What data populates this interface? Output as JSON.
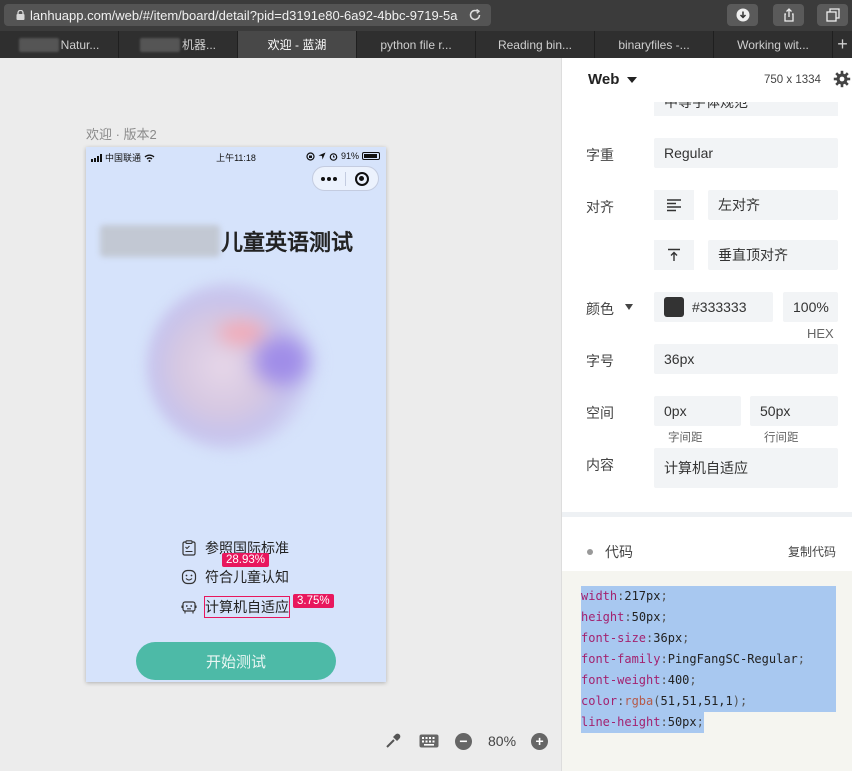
{
  "browser": {
    "url": "lanhuapp.com/web/#/item/board/detail?pid=d3191e80-6a92-4bbc-9719-5a",
    "tabs": [
      {
        "label": "Natur...",
        "active": false,
        "blurred": true
      },
      {
        "label": "机器...",
        "active": false,
        "blurred": true
      },
      {
        "label": "欢迎 - 蓝湖",
        "active": true,
        "blurred": false
      },
      {
        "label": "python file r...",
        "active": false,
        "blurred": false
      },
      {
        "label": "Reading bin...",
        "active": false,
        "blurred": false
      },
      {
        "label": "binaryfiles -...",
        "active": false,
        "blurred": false
      },
      {
        "label": "Working wit...",
        "active": false,
        "blurred": false
      }
    ],
    "new_tab": "+"
  },
  "canvas": {
    "artboard_title": "欢迎 · 版本2",
    "zoom": "80%",
    "zoom_minus": "−",
    "zoom_plus": "+"
  },
  "phone": {
    "status": {
      "carrier": "中国联通",
      "time": "上午11:18",
      "battery": "91%"
    },
    "title": "儿童英语测试",
    "features": [
      {
        "text": "参照国际标准",
        "icon": "clipboard-icon"
      },
      {
        "text": "符合儿童认知",
        "icon": "smile-icon"
      },
      {
        "text": "计算机自适应",
        "icon": "robot-icon",
        "selected": true
      }
    ],
    "overlay": {
      "spacing_top": "28.93%",
      "spacing_right": "3.75%"
    },
    "start_button": "开始测试"
  },
  "panel": {
    "platform": "Web",
    "size": "750 x 1334",
    "cut_field": "中等字体规范",
    "weight_label": "字重",
    "weight_value": "Regular",
    "align_label": "对齐",
    "align_h": "左对齐",
    "align_v": "垂直顶对齐",
    "color_label": "颜色",
    "color_hex": "#333333",
    "color_opacity": "100%",
    "color_mode": "HEX",
    "size_label": "字号",
    "font_size": "36px",
    "space_label": "空间",
    "letter_spacing": "0px",
    "line_height": "50px",
    "letter_spacing_label": "字间距",
    "line_height_label": "行间距",
    "content_label": "内容",
    "content_value": "计算机自适应",
    "code_title": "代码",
    "copy_code": "复制代码",
    "code": [
      {
        "key": "width",
        "val": "217px"
      },
      {
        "key": "height",
        "val": "50px"
      },
      {
        "key": "font-size",
        "val": "36px"
      },
      {
        "key": "font-family",
        "val": "PingFangSC-Regular"
      },
      {
        "key": "font-weight",
        "val": "400"
      },
      {
        "key": "color",
        "func": "rgba",
        "args": "51,51,51,1"
      },
      {
        "key": "line-height",
        "val": "50px"
      }
    ]
  }
}
